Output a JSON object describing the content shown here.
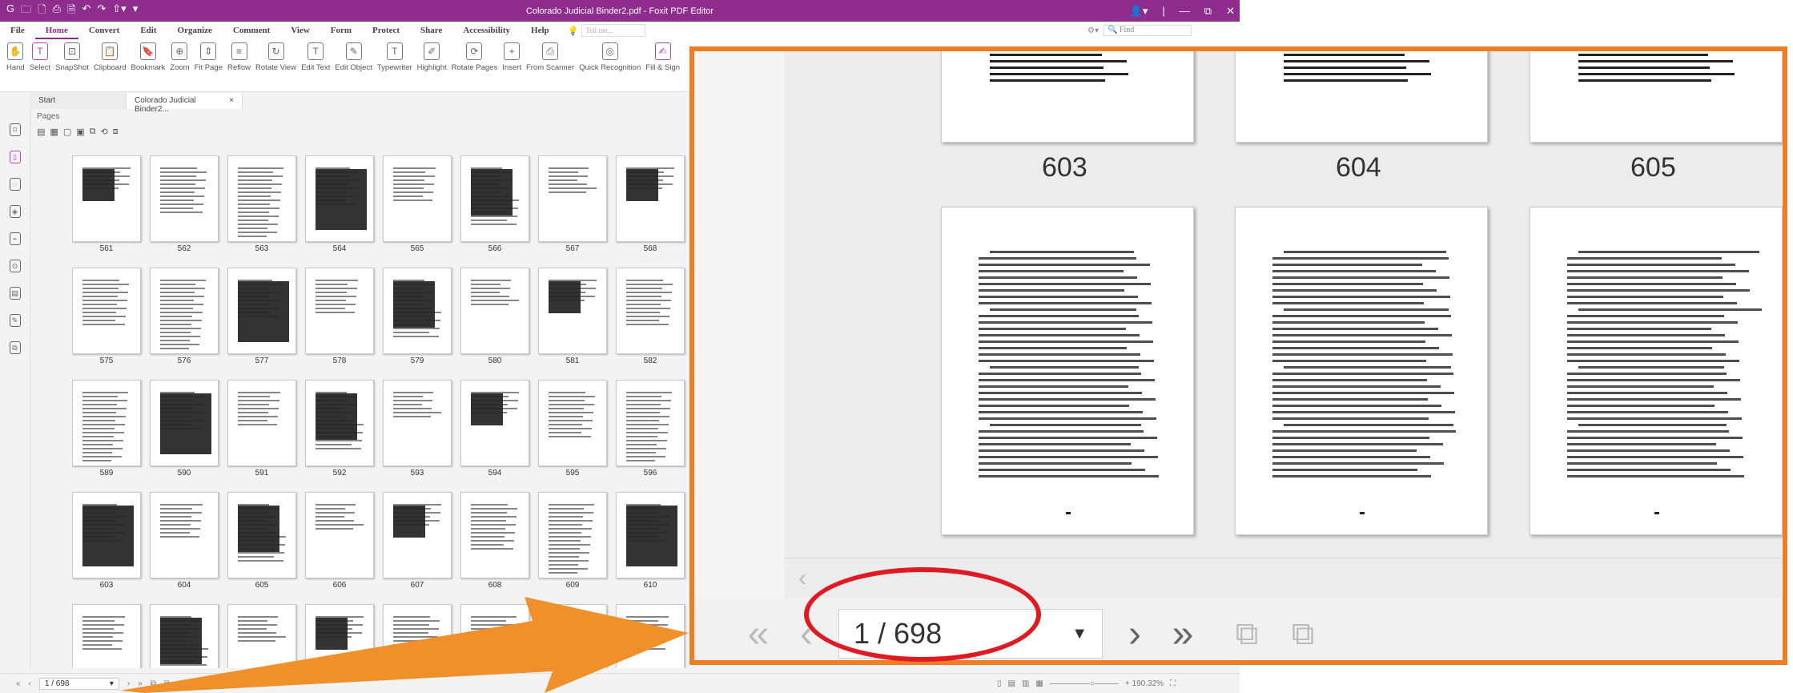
{
  "window": {
    "title": "Colorado Judicial Binder2.pdf - Foxit PDF Editor",
    "quick_access": [
      "G",
      "🗀",
      "🗋",
      "⎙",
      "🗎",
      "↶",
      "↷",
      "⇧▾",
      "▾"
    ],
    "controls": [
      "👤▾",
      "|",
      "—",
      "⧉",
      "✕"
    ]
  },
  "menu": {
    "items": [
      "File",
      "Home",
      "Convert",
      "Edit",
      "Organize",
      "Comment",
      "View",
      "Form",
      "Protect",
      "Share",
      "Accessibility",
      "Help"
    ],
    "active": "Home",
    "tell_me": "Tell me...",
    "find_placeholder": "Find"
  },
  "ribbon": {
    "buttons": [
      {
        "label": "Hand",
        "glyph": "✋"
      },
      {
        "label": "Select",
        "glyph": "T"
      },
      {
        "label": "SnapShot",
        "glyph": "⊡"
      },
      {
        "label": "Clipboard",
        "glyph": "📋"
      },
      {
        "label": "Bookmark",
        "glyph": "🔖"
      },
      {
        "label": "Zoom",
        "glyph": "⊕"
      },
      {
        "label": "Fit Page",
        "glyph": "⇕"
      },
      {
        "label": "Reflow",
        "glyph": "≡"
      },
      {
        "label": "Rotate View",
        "glyph": "↻"
      },
      {
        "label": "Edit Text",
        "glyph": "T"
      },
      {
        "label": "Edit Object",
        "glyph": "✎"
      },
      {
        "label": "Typewriter",
        "glyph": "T"
      },
      {
        "label": "Highlight",
        "glyph": "✐"
      },
      {
        "label": "Rotate Pages",
        "glyph": "⟳"
      },
      {
        "label": "Insert",
        "glyph": "+"
      },
      {
        "label": "From Scanner",
        "glyph": "⎙"
      },
      {
        "label": "Quick Recognition",
        "glyph": "◎"
      },
      {
        "label": "Fill & Sign",
        "glyph": "✍"
      }
    ]
  },
  "tabs": {
    "start": "Start",
    "document": "Colorado Judicial Binder2...",
    "close": "×"
  },
  "left_panel": {
    "title": "Pages",
    "icons": [
      "bookmark-icon",
      "pages-icon",
      "comments-icon",
      "layers-icon",
      "attachments-icon",
      "security-icon",
      "content-icon",
      "signatures-icon",
      "destinations-icon"
    ]
  },
  "thumbnails": {
    "page_labels": [
      "561",
      "562",
      "563",
      "564",
      "565",
      "566",
      "567",
      "568",
      "575",
      "576",
      "577",
      "578",
      "579",
      "580",
      "581",
      "582",
      "589",
      "590",
      "591",
      "592",
      "593",
      "594",
      "595",
      "596",
      "603",
      "604",
      "605",
      "606",
      "607",
      "608",
      "609",
      "610",
      "",
      "",
      "",
      "",
      "",
      "",
      "",
      ""
    ]
  },
  "status": {
    "first": "«",
    "prev": "‹",
    "page_value": "1 / 698",
    "next": "›",
    "last": "»",
    "zoom_value": "+ 190.32%"
  },
  "callout": {
    "page_labels": [
      "603",
      "604",
      "605"
    ],
    "page_value": "1 / 698",
    "first": "«",
    "prev": "‹",
    "next": "›",
    "last": "»",
    "scroll_left": "‹"
  },
  "colors": {
    "brand": "#8e2d8e",
    "callout_border": "#f07d23",
    "highlight_ring": "#e01a22"
  }
}
